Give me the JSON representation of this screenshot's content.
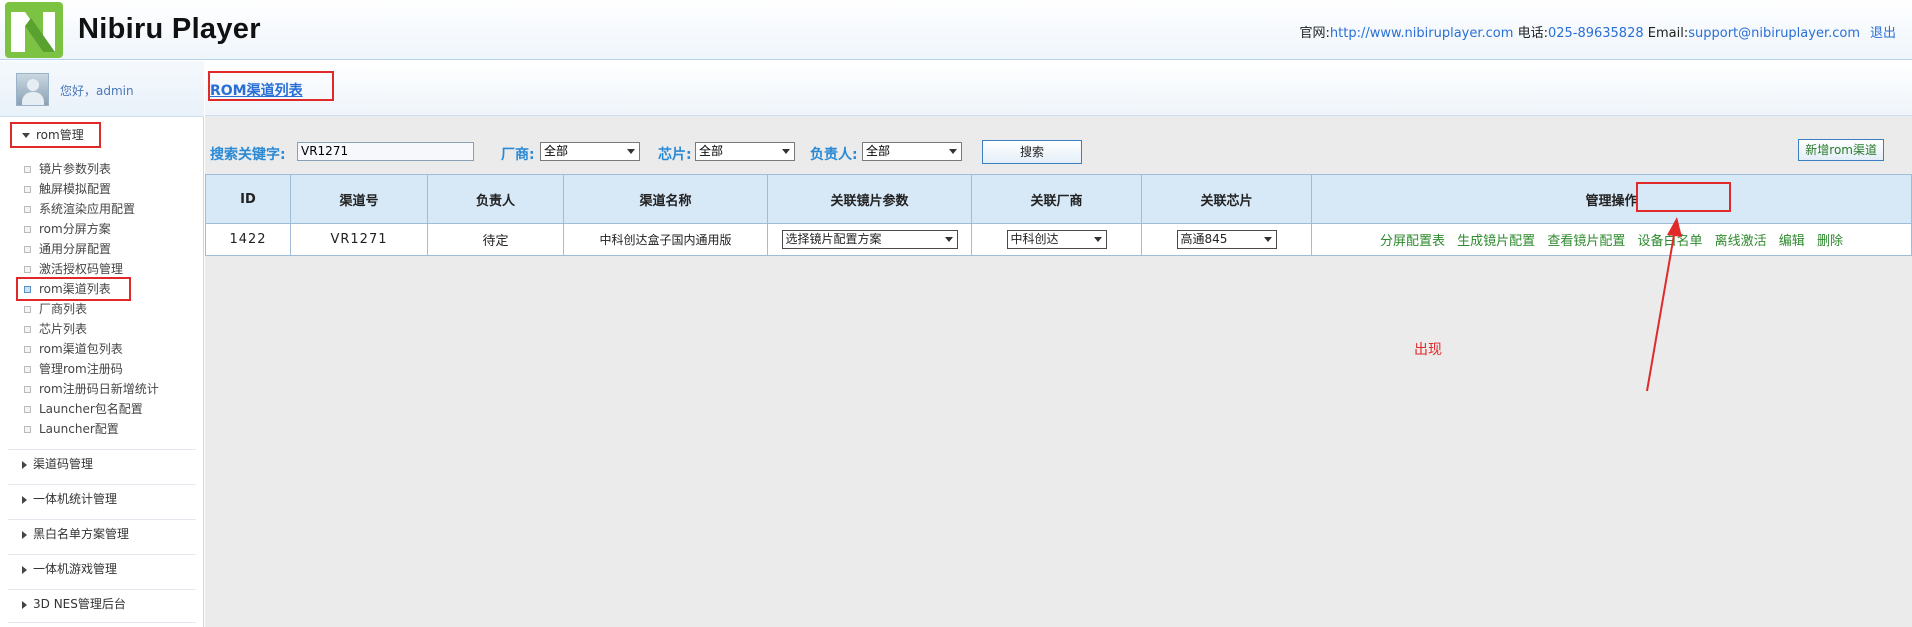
{
  "header": {
    "brand": "Nibiru Player",
    "site_label": "官网:",
    "site_url": "http://www.nibiruplayer.com",
    "phone_label": "电话:",
    "phone": "025-89635828",
    "email_label": "Email:",
    "email": "support@nibiruplayer.com",
    "logout": "退出"
  },
  "sidebar": {
    "greeting": "您好，admin",
    "sections": [
      {
        "label": "rom管理",
        "expanded": true
      },
      {
        "label": "渠道码管理"
      },
      {
        "label": "一体机统计管理"
      },
      {
        "label": "黑白名单方案管理"
      },
      {
        "label": "一体机游戏管理"
      },
      {
        "label": "3D NES管理后台"
      }
    ],
    "rom_items": [
      "镜片参数列表",
      "触屏模拟配置",
      "系统渲染应用配置",
      "rom分屏方案",
      "通用分屏配置",
      "激活授权码管理",
      "rom渠道列表",
      "厂商列表",
      "芯片列表",
      "rom渠道包列表",
      "管理rom注册码",
      "rom注册码日新增统计",
      "Launcher包名配置",
      "Launcher配置"
    ]
  },
  "main": {
    "title": "ROM渠道列表",
    "search": {
      "keyword_label": "搜索关键字:",
      "keyword_value": "VR1271",
      "vendor_label": "厂商:",
      "vendor_value": "全部",
      "chip_label": "芯片:",
      "chip_value": "全部",
      "owner_label": "负责人:",
      "owner_value": "全部",
      "search_button": "搜索"
    },
    "new_button": "新增rom渠道",
    "table": {
      "headers": [
        "ID",
        "渠道号",
        "负责人",
        "渠道名称",
        "关联镜片参数",
        "关联厂商",
        "关联芯片",
        "管理操作"
      ],
      "rows": [
        {
          "id": "1422",
          "channel": "VR1271",
          "owner": "待定",
          "name": "中科创达盒子国内通用版",
          "lens": "选择镜片配置方案",
          "vendor": "中科创达",
          "chip": "高通845",
          "actions": [
            "分屏配置表",
            "生成镜片配置",
            "查看镜片配置",
            "设备白名单",
            "离线激活",
            "编辑",
            "删除"
          ]
        }
      ]
    },
    "annotation": "出现"
  },
  "colors": {
    "accent": "#2a6fd6",
    "highlight": "#e02a2a",
    "action_link": "#2e8a2e",
    "table_header": "#d7e8f7"
  }
}
